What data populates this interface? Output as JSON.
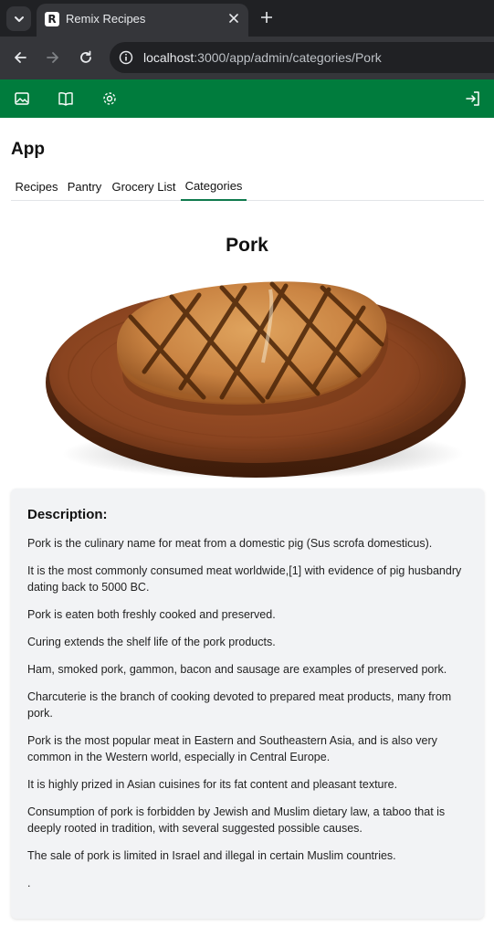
{
  "browser": {
    "tab_title": "Remix Recipes",
    "favicon_letter": "R",
    "url_host": "localhost",
    "url_path": ":3000/app/admin/categories/Pork"
  },
  "colors": {
    "brand_green": "#007c3d",
    "tab_underline": "#0f7a4d",
    "card_bg": "#f2f3f5"
  },
  "header": {
    "icons": [
      "image-icon",
      "book-open-icon",
      "gear-icon",
      "logout-icon"
    ]
  },
  "app_title": "App",
  "nav_tabs": [
    {
      "label": "Recipes"
    },
    {
      "label": "Pantry"
    },
    {
      "label": "Grocery List"
    },
    {
      "label": "Categories",
      "active": true
    }
  ],
  "category": {
    "title": "Pork",
    "image_subject": "grilled pork chop on a wooden board"
  },
  "description": {
    "heading": "Description:",
    "paragraphs": [
      "Pork is the culinary name for meat from a domestic pig (Sus scrofa domesticus).",
      "It is the most commonly consumed meat worldwide,[1] with evidence of pig husbandry dating back to 5000 BC.",
      "Pork is eaten both freshly cooked and preserved.",
      "Curing extends the shelf life of the pork products.",
      "Ham, smoked pork, gammon, bacon and sausage are examples of preserved pork.",
      "Charcuterie is the branch of cooking devoted to prepared meat products, many from pork.",
      "Pork is the most popular meat in Eastern and Southeastern Asia, and is also very common in the Western world, especially in Central Europe.",
      "It is highly prized in Asian cuisines for its fat content and pleasant texture.",
      "Consumption of pork is forbidden by Jewish and Muslim dietary law, a taboo that is deeply rooted in tradition, with several suggested possible causes.",
      "The sale of pork is limited in Israel and illegal in certain Muslim countries.",
      "."
    ]
  }
}
